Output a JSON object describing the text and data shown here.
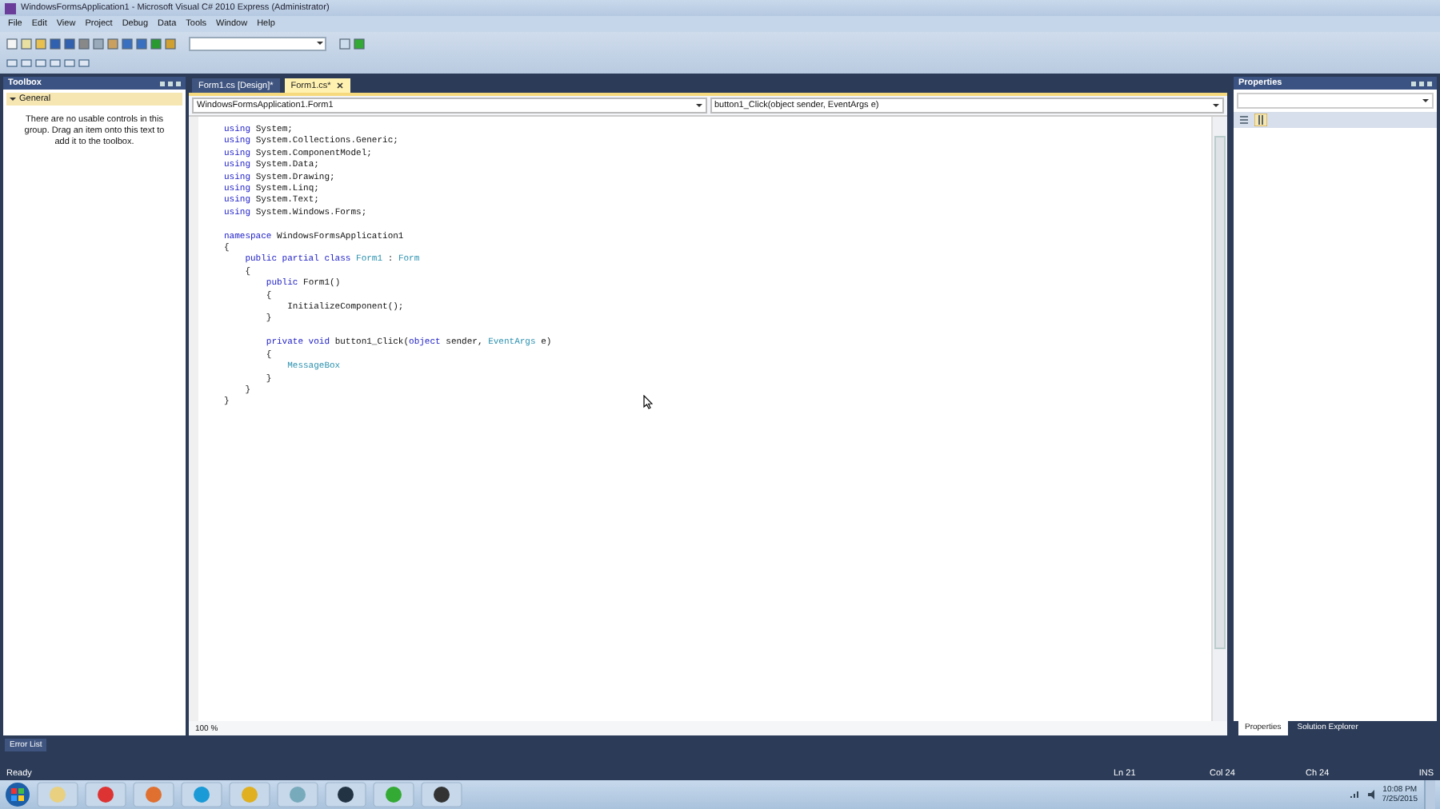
{
  "window": {
    "title": "WindowsFormsApplication1 - Microsoft Visual C# 2010 Express (Administrator)"
  },
  "menu": [
    "File",
    "Edit",
    "View",
    "Project",
    "Debug",
    "Data",
    "Tools",
    "Window",
    "Help"
  ],
  "toolbox": {
    "title": "Toolbox",
    "group": {
      "label": "General",
      "expanded": true
    },
    "message": "There are no usable controls in this group. Drag an item onto this text to add it to the toolbox."
  },
  "editor": {
    "tabs": [
      {
        "label": "Form1.cs [Design]*",
        "selected": false
      },
      {
        "label": "Form1.cs*",
        "selected": true
      }
    ],
    "class_dropdown": "WindowsFormsApplication1.Form1",
    "member_dropdown": "button1_Click(object sender, EventArgs e)",
    "code": [
      {
        "tokens": [
          {
            "kw": "using"
          },
          {
            "plain": " System;"
          }
        ]
      },
      {
        "tokens": [
          {
            "kw": "using"
          },
          {
            "plain": " System.Collections.Generic;"
          }
        ]
      },
      {
        "tokens": [
          {
            "kw": "using"
          },
          {
            "plain": " System.ComponentModel;"
          }
        ]
      },
      {
        "tokens": [
          {
            "kw": "using"
          },
          {
            "plain": " System.Data;"
          }
        ]
      },
      {
        "tokens": [
          {
            "kw": "using"
          },
          {
            "plain": " System.Drawing;"
          }
        ]
      },
      {
        "tokens": [
          {
            "kw": "using"
          },
          {
            "plain": " System.Linq;"
          }
        ]
      },
      {
        "tokens": [
          {
            "kw": "using"
          },
          {
            "plain": " System.Text;"
          }
        ]
      },
      {
        "tokens": [
          {
            "kw": "using"
          },
          {
            "plain": " System.Windows.Forms;"
          }
        ]
      },
      {
        "gap_before": true,
        "tokens": [
          {
            "kw": "namespace"
          },
          {
            "plain": " WindowsFormsApplication1"
          }
        ]
      },
      {
        "tokens": [
          {
            "plain": "{"
          }
        ]
      },
      {
        "tokens": [
          {
            "kw": "    public partial class"
          },
          {
            "type": " Form1"
          },
          {
            "plain": " : "
          },
          {
            "type": "Form"
          }
        ]
      },
      {
        "tokens": [
          {
            "plain": "    {"
          }
        ]
      },
      {
        "tokens": [
          {
            "kw": "        public"
          },
          {
            "plain": " Form1()"
          }
        ]
      },
      {
        "tokens": [
          {
            "plain": "        {"
          }
        ]
      },
      {
        "tokens": [
          {
            "plain": "            InitializeComponent();"
          }
        ]
      },
      {
        "tokens": [
          {
            "plain": "        }"
          }
        ]
      },
      {
        "gap_before": true,
        "tokens": [
          {
            "kw": "        private void"
          },
          {
            "plain": " button1_Click("
          },
          {
            "kw": "object"
          },
          {
            "plain": " sender, "
          },
          {
            "type": "EventArgs"
          },
          {
            "plain": " e)"
          }
        ]
      },
      {
        "tokens": [
          {
            "plain": "        {"
          }
        ]
      },
      {
        "tokens": [
          {
            "type": "            MessageBox"
          }
        ]
      },
      {
        "tokens": [
          {
            "plain": "        }"
          }
        ]
      },
      {
        "tokens": [
          {
            "plain": "    }"
          }
        ]
      },
      {
        "tokens": [
          {
            "plain": "}"
          }
        ]
      }
    ],
    "zoom": "100 %"
  },
  "properties": {
    "title": "Properties"
  },
  "bottom_tabs": [
    {
      "label": "Properties",
      "selected": true
    },
    {
      "label": "Solution Explorer",
      "selected": false
    }
  ],
  "error_list_tab": "Error List",
  "status_bar": {
    "message": "Ready",
    "line": "Ln 21",
    "column": "Col 24",
    "char": "Ch 24",
    "mode": "INS"
  },
  "taskbar": {
    "time": "10:08 PM",
    "date": "7/25/2015"
  }
}
